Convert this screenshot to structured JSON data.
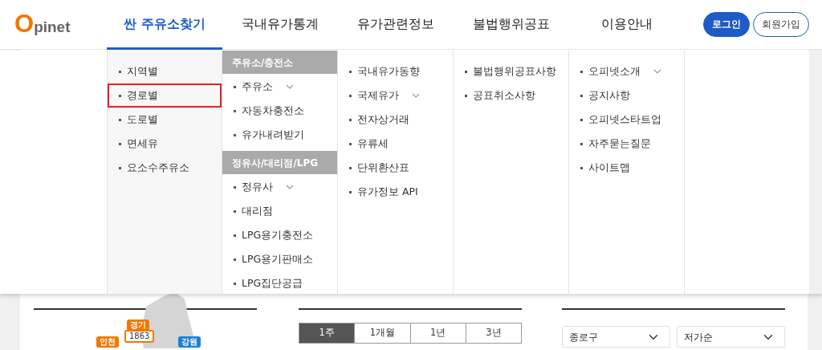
{
  "logo": "Opinet",
  "nav": [
    {
      "label": "싼 주유소찾기",
      "selected": true
    },
    {
      "label": "국내유가통계",
      "selected": false
    },
    {
      "label": "유가관련정보",
      "selected": false
    },
    {
      "label": "불법행위공표",
      "selected": false
    },
    {
      "label": "이용안내",
      "selected": false
    }
  ],
  "auth_buttons": [
    {
      "label": "로그인",
      "kind": "primary"
    },
    {
      "label": "회원가입",
      "kind": "outline"
    }
  ],
  "mega_menu": {
    "columns": [
      {
        "sections": [
          {
            "items": [
              {
                "label": "지역별",
                "has_submenu": false,
                "highlighted": false
              },
              {
                "label": "경로별",
                "has_submenu": false,
                "highlighted": true
              },
              {
                "label": "도로별",
                "has_submenu": false,
                "highlighted": false
              },
              {
                "label": "면세유",
                "has_submenu": false,
                "highlighted": false
              },
              {
                "label": "요소수주유소",
                "has_submenu": false,
                "highlighted": false
              }
            ]
          }
        ]
      },
      {
        "sections": [
          {
            "header": "주유소/충전소",
            "items": [
              {
                "label": "주유소",
                "has_submenu": true,
                "highlighted": false
              },
              {
                "label": "자동차충전소",
                "has_submenu": false,
                "highlighted": false
              },
              {
                "label": "유가내려받기",
                "has_submenu": false,
                "highlighted": false
              }
            ]
          },
          {
            "header": "정유사/대리점/LPG",
            "items": [
              {
                "label": "정유사",
                "has_submenu": true,
                "highlighted": false
              },
              {
                "label": "대리점",
                "has_submenu": false,
                "highlighted": false
              },
              {
                "label": "LPG용기충전소",
                "has_submenu": false,
                "highlighted": false
              },
              {
                "label": "LPG용기판매소",
                "has_submenu": false,
                "highlighted": false
              },
              {
                "label": "LPG집단공급",
                "has_submenu": false,
                "highlighted": false
              }
            ]
          }
        ]
      },
      {
        "sections": [
          {
            "items": [
              {
                "label": "국내유가동향",
                "has_submenu": false,
                "highlighted": false
              },
              {
                "label": "국제유가",
                "has_submenu": true,
                "highlighted": false
              },
              {
                "label": "전자상거래",
                "has_submenu": false,
                "highlighted": false
              },
              {
                "label": "유류세",
                "has_submenu": false,
                "highlighted": false
              },
              {
                "label": "단위환산표",
                "has_submenu": false,
                "highlighted": false
              },
              {
                "label": "유가정보 API",
                "has_submenu": false,
                "highlighted": false
              }
            ]
          }
        ]
      },
      {
        "sections": [
          {
            "items": [
              {
                "label": "불법행위공표사항",
                "has_submenu": false,
                "highlighted": false
              },
              {
                "label": "공표취소사항",
                "has_submenu": false,
                "highlighted": false
              }
            ]
          }
        ]
      },
      {
        "sections": [
          {
            "items": [
              {
                "label": "오피넷소개",
                "has_submenu": true,
                "highlighted": false
              },
              {
                "label": "공지사항",
                "has_submenu": false,
                "highlighted": false
              },
              {
                "label": "오피넷스타트업",
                "has_submenu": false,
                "highlighted": false
              },
              {
                "label": "자주묻는질문",
                "has_submenu": false,
                "highlighted": false
              },
              {
                "label": "사이트맵",
                "has_submenu": false,
                "highlighted": false
              }
            ]
          }
        ]
      }
    ]
  },
  "background_page": {
    "map_markers": [
      {
        "label": "경기",
        "count": "1863",
        "color": "#f07800"
      },
      {
        "label": "인천",
        "color": "#f07800"
      },
      {
        "label": "강원",
        "color": "#1c82d4"
      }
    ],
    "period_tabs": [
      {
        "label": "1주",
        "selected": true
      },
      {
        "label": "1개월",
        "selected": false
      },
      {
        "label": "1년",
        "selected": false
      },
      {
        "label": "3년",
        "selected": false
      }
    ],
    "selects": [
      {
        "value": "종로구"
      },
      {
        "value": "저가순"
      }
    ]
  }
}
